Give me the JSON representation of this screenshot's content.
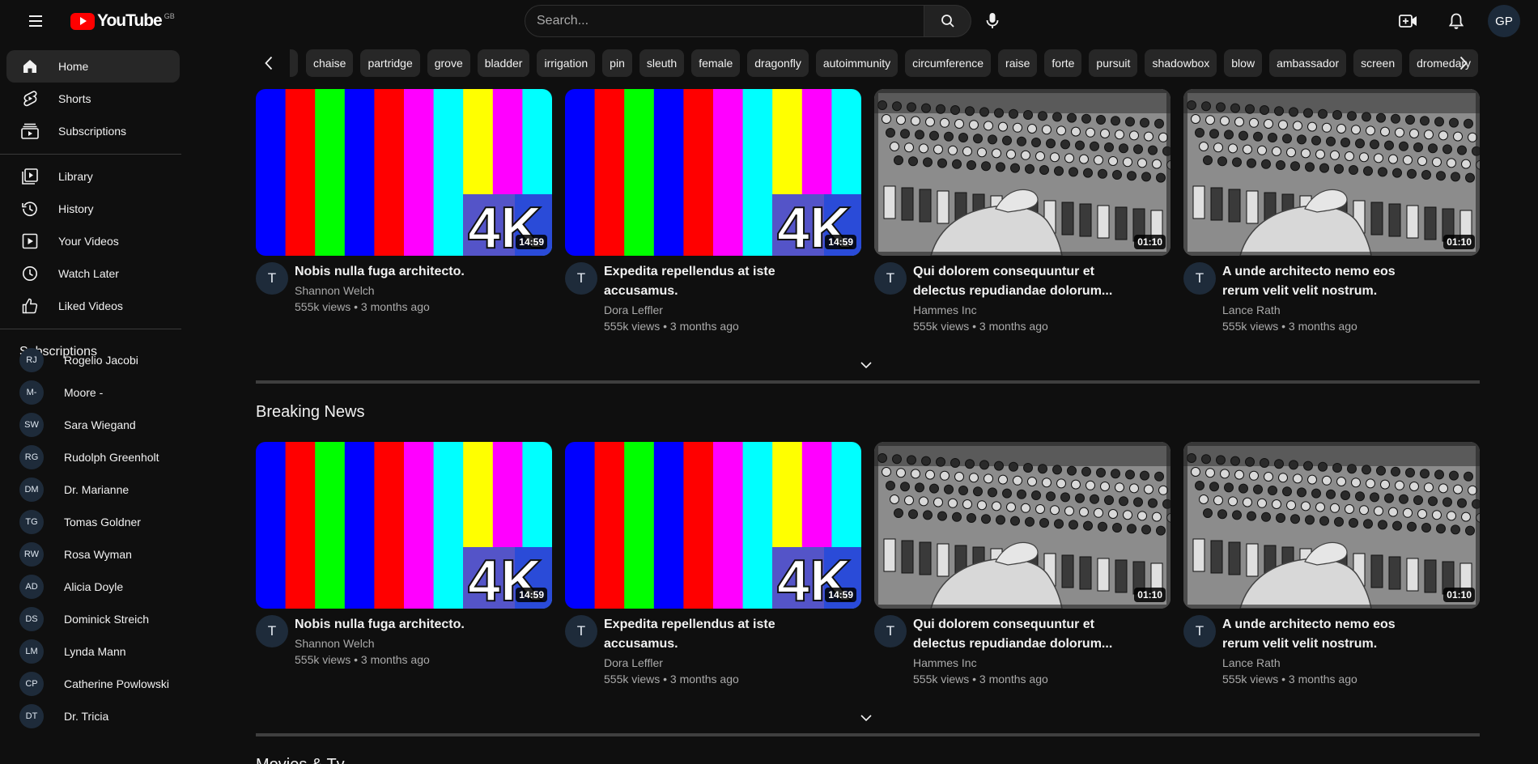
{
  "header": {
    "logo_text": "YouTube",
    "region": "GB",
    "search_placeholder": "Search...",
    "avatar_initials": "GP"
  },
  "sidebar": {
    "main": [
      {
        "label": "Home",
        "icon": "home-icon",
        "active": true
      },
      {
        "label": "Shorts",
        "icon": "shorts-icon"
      },
      {
        "label": "Subscriptions",
        "icon": "subscriptions-icon"
      }
    ],
    "library": [
      {
        "label": "Library",
        "icon": "library-icon"
      },
      {
        "label": "History",
        "icon": "history-icon"
      },
      {
        "label": "Your Videos",
        "icon": "your-videos-icon"
      },
      {
        "label": "Watch Later",
        "icon": "watch-later-icon"
      },
      {
        "label": "Liked Videos",
        "icon": "thumbs-up-icon"
      }
    ],
    "subscriptions_title": "Subscriptions",
    "subscriptions": [
      {
        "initials": "RJ",
        "name": "Rogelio Jacobi"
      },
      {
        "initials": "M-",
        "name": "Moore -"
      },
      {
        "initials": "SW",
        "name": "Sara Wiegand"
      },
      {
        "initials": "RG",
        "name": "Rudolph Greenholt"
      },
      {
        "initials": "DM",
        "name": "Dr. Marianne"
      },
      {
        "initials": "TG",
        "name": "Tomas Goldner"
      },
      {
        "initials": "RW",
        "name": "Rosa Wyman"
      },
      {
        "initials": "AD",
        "name": "Alicia Doyle"
      },
      {
        "initials": "DS",
        "name": "Dominick Streich"
      },
      {
        "initials": "LM",
        "name": "Lynda Mann"
      },
      {
        "initials": "CP",
        "name": "Catherine Powlowski"
      },
      {
        "initials": "DT",
        "name": "Dr. Tricia"
      }
    ]
  },
  "chips": [
    "chaise",
    "partridge",
    "grove",
    "bladder",
    "irrigation",
    "pin",
    "sleuth",
    "female",
    "dragonfly",
    "autoimmunity",
    "circumference",
    "raise",
    "forte",
    "pursuit",
    "shadowbox",
    "blow",
    "ambassador",
    "screen",
    "dromedary"
  ],
  "sections": [
    {
      "title": "",
      "videos": [
        {
          "thumb": "colorbars",
          "duration": "14:59",
          "avatar": "T",
          "title_lines": [
            "Nobis nulla fuga architecto."
          ],
          "channel": "Shannon Welch",
          "stats": "555k views • 3 months ago"
        },
        {
          "thumb": "colorbars",
          "duration": "14:59",
          "avatar": "T",
          "title_lines": [
            "Expedita repellendus at iste",
            "accusamus."
          ],
          "channel": "Dora Leffler",
          "stats": "555k views • 3 months ago"
        },
        {
          "thumb": "mixer",
          "duration": "01:10",
          "avatar": "T",
          "title_lines": [
            "Qui dolorem consequuntur et",
            "delectus repudiandae dolorum..."
          ],
          "channel": "Hammes Inc",
          "stats": "555k views • 3 months ago"
        },
        {
          "thumb": "mixer",
          "duration": "01:10",
          "avatar": "T",
          "title_lines": [
            "A unde architecto nemo eos",
            "rerum velit velit nostrum."
          ],
          "channel": "Lance Rath",
          "stats": "555k views • 3 months ago"
        }
      ]
    },
    {
      "title": "Breaking News",
      "videos": [
        {
          "thumb": "colorbars",
          "duration": "14:59",
          "avatar": "T",
          "title_lines": [
            "Nobis nulla fuga architecto."
          ],
          "channel": "Shannon Welch",
          "stats": "555k views • 3 months ago"
        },
        {
          "thumb": "colorbars",
          "duration": "14:59",
          "avatar": "T",
          "title_lines": [
            "Expedita repellendus at iste",
            "accusamus."
          ],
          "channel": "Dora Leffler",
          "stats": "555k views • 3 months ago"
        },
        {
          "thumb": "mixer",
          "duration": "01:10",
          "avatar": "T",
          "title_lines": [
            "Qui dolorem consequuntur et",
            "delectus repudiandae dolorum..."
          ],
          "channel": "Hammes Inc",
          "stats": "555k views • 3 months ago"
        },
        {
          "thumb": "mixer",
          "duration": "01:10",
          "avatar": "T",
          "title_lines": [
            "A unde architecto nemo eos",
            "rerum velit velit nostrum."
          ],
          "channel": "Lance Rath",
          "stats": "555k views • 3 months ago"
        }
      ]
    },
    {
      "title": "Movies & Tv",
      "videos": []
    }
  ],
  "thumb_badge": "4K",
  "colors": {
    "background": "#0f0f0f",
    "chip": "#272727",
    "active_nav": "#272727",
    "brand_red": "#ff0000",
    "secondary_text": "#aaaaaa"
  }
}
